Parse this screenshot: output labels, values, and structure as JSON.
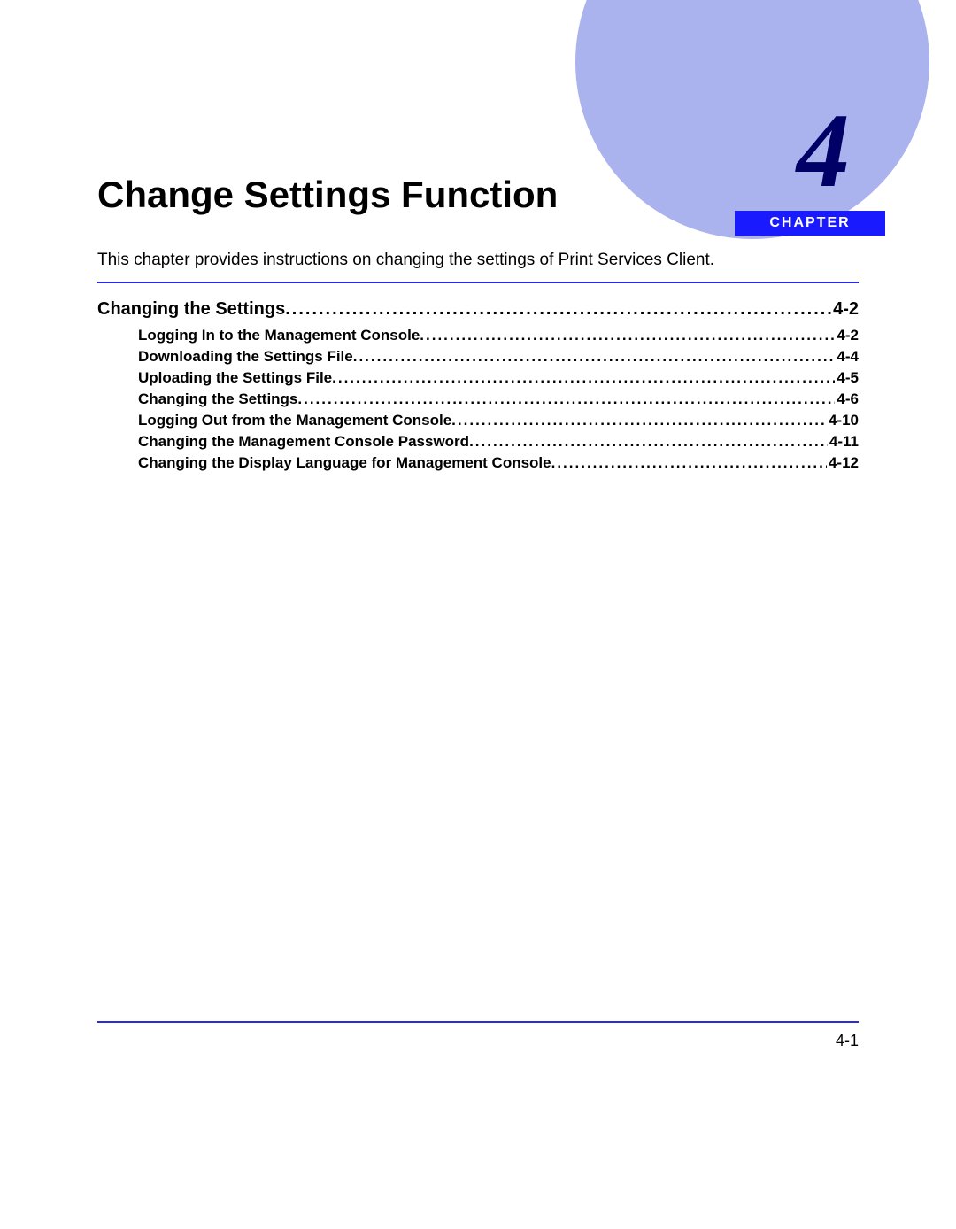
{
  "chapter": {
    "number": "4",
    "label": "CHAPTER"
  },
  "title": "Change Settings Function",
  "intro": "This chapter provides instructions on changing the settings of Print Services Client.",
  "toc": {
    "section": {
      "label": "Changing the Settings",
      "page": "4-2"
    },
    "items": [
      {
        "label": "Logging In to the Management Console",
        "page": "4-2"
      },
      {
        "label": "Downloading the Settings File",
        "page": "4-4"
      },
      {
        "label": "Uploading the Settings File",
        "page": "4-5"
      },
      {
        "label": "Changing the Settings",
        "page": "4-6"
      },
      {
        "label": "Logging Out from the Management Console",
        "page": "4-10"
      },
      {
        "label": "Changing the Management Console Password",
        "page": "4-11"
      },
      {
        "label": "Changing the Display Language for Management Console",
        "page": "4-12"
      }
    ]
  },
  "pageNumber": "4-1"
}
